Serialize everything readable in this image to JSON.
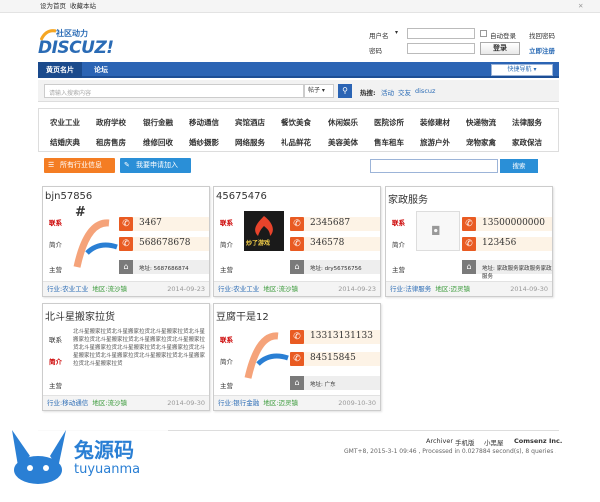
{
  "topbar": {
    "set_home": "设为首页",
    "bookmark": "收藏本站",
    "close": "✕"
  },
  "header": {
    "logo_tagline": "社区动力",
    "logo_text": "DISCUZ!",
    "username_label": "用户名",
    "password_label": "密码",
    "auto_login": "自动登录",
    "forgot_password": "找回密码",
    "login_button": "登录",
    "register_link": "立即注册"
  },
  "nav": {
    "tabs": [
      "黄页名片",
      "论坛"
    ],
    "quick_nav": "快捷导航"
  },
  "search": {
    "placeholder": "请输入搜索内容",
    "scope": "帖子",
    "button": "搜索",
    "hot_label": "热搜:",
    "hot_terms": [
      "活动",
      "交友",
      "discuz"
    ]
  },
  "categories": {
    "row1": [
      "农业工业",
      "政府学校",
      "银行金融",
      "移动通信",
      "宾馆酒店",
      "餐饮美食",
      "休闲娱乐",
      "医院诊所",
      "装修建材",
      "快递物流",
      "法律服务"
    ],
    "row2": [
      "结婚庆典",
      "租房售房",
      "维修回收",
      "婚纱摄影",
      "网络服务",
      "礼品鲜花",
      "美容美体",
      "售车租车",
      "旅游户外",
      "宠物家禽",
      "家政保洁"
    ]
  },
  "actions": {
    "all_industries": "所有行业信息",
    "apply": "我要申请加入",
    "search_button": "搜索"
  },
  "cards": [
    {
      "title": "bjn57856",
      "contact_label": "联系",
      "intro_label": "简介",
      "business_label": "主营",
      "phone1": "3467",
      "phone2": "568678678",
      "address_label": "地址:",
      "address": "5687686874",
      "industry_label": "行业:",
      "industry": "农业工业",
      "area_label": "地区:",
      "area": "流沙镇",
      "date": "2014-09-23",
      "image_mark": "#"
    },
    {
      "title": "45675476",
      "contact_label": "联系",
      "intro_label": "简介",
      "business_label": "主营",
      "phone1": "2345687",
      "phone2": "346578",
      "address_label": "地址:",
      "address": "dry56756756",
      "industry_label": "行业:",
      "industry": "农业工业",
      "area_label": "地区:",
      "area": "流沙镇",
      "date": "2014-09-23",
      "image_text": "炒了游戏"
    },
    {
      "title": "家政服务",
      "contact_label": "联系",
      "intro_label": "简介",
      "business_label": "主营",
      "phone1": "13500000000",
      "phone2": "123456",
      "address_label": "地址:",
      "address": "家政服务家政服务家政服务",
      "industry_label": "行业:",
      "industry": "法律服务",
      "area_label": "地区:",
      "area": "迈灵镇",
      "date": "2014-09-30"
    },
    {
      "title": "北斗星搬家拉货",
      "contact_label": "联系",
      "intro_label": "简介",
      "business_label": "主营",
      "description": "北斗星搬家拉货北斗星搬家拉货北斗星搬家拉货北斗星搬家拉货北斗星搬家拉货北斗星搬家拉货北斗星搬家拉货北斗星搬家拉货北斗星搬家拉货北斗星搬家拉货北斗星搬家拉货北斗星搬家拉货北斗星搬家拉货北斗星搬家拉货北斗星搬家拉货",
      "industry_label": "行业:",
      "industry": "移动通信",
      "area_label": "地区:",
      "area": "流沙镇",
      "date": "2014-09-30"
    },
    {
      "title": "豆腐干是12",
      "contact_label": "联系",
      "intro_label": "简介",
      "business_label": "主营",
      "phone1": "13313131133",
      "phone2": "84515845",
      "address_label": "地址:",
      "address": "广东",
      "industry_label": "行业:",
      "industry": "银行金融",
      "area_label": "地区:",
      "area": "迈灵镇",
      "date": "2009-10-30"
    }
  ],
  "footer": {
    "links": [
      "Archiver",
      "手机版",
      "小黑屋",
      "Comsenz Inc."
    ],
    "stats": "GMT+8, 2015-3-1 09:46 , Processed in 0.027884 second(s), 8 queries .",
    "watermark_cn": "兔源码",
    "watermark_en": "tuyuanma"
  },
  "colors": {
    "nav": "#2b64b4",
    "orange": "#f47d23",
    "blue_button": "#2a8fd7",
    "phone_icon": "#e95b22"
  }
}
